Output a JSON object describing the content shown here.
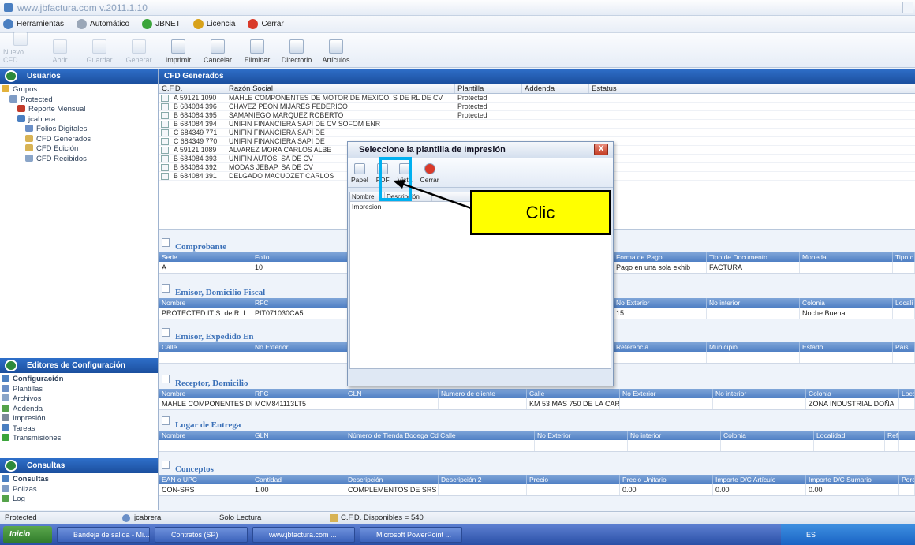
{
  "window": {
    "title": "www.jbfactura.com  v.2011.1.10"
  },
  "menu": [
    {
      "label": "Herramientas",
      "color": "#4a7fc1"
    },
    {
      "label": "Automático",
      "color": "#9aa7b8"
    },
    {
      "label": "JBNET",
      "color": "#3ba53b"
    },
    {
      "label": "Licencia",
      "color": "#d8a21a"
    },
    {
      "label": "Cerrar",
      "color": "#d93a2a"
    }
  ],
  "toolbar": [
    {
      "label": "Nuevo CFD",
      "enabled": false
    },
    {
      "label": "Abrir",
      "enabled": false
    },
    {
      "label": "Guardar",
      "enabled": false
    },
    {
      "label": "Generar",
      "enabled": false
    },
    {
      "label": "Imprimir",
      "enabled": true
    },
    {
      "label": "Cancelar",
      "enabled": true
    },
    {
      "label": "Eliminar",
      "enabled": true
    },
    {
      "label": "Directorio",
      "enabled": true
    },
    {
      "label": "Artículos",
      "enabled": true
    }
  ],
  "left": {
    "usuarios_header": "Usuarios",
    "tree": [
      {
        "label": "Grupos",
        "indent": 0,
        "color": "#e3b23c"
      },
      {
        "label": "Protected",
        "indent": 1,
        "color": "#7f9cc5"
      },
      {
        "label": "Reporte Mensual",
        "indent": 2,
        "color": "#c23b2a"
      },
      {
        "label": "jcabrera",
        "indent": 2,
        "color": "#4a7fc1"
      },
      {
        "label": "Folios Digitales",
        "indent": 3,
        "color": "#6a8fc7"
      },
      {
        "label": "CFD Generados",
        "indent": 3,
        "color": "#d8b354"
      },
      {
        "label": "CFD Edición",
        "indent": 3,
        "color": "#d8b354"
      },
      {
        "label": "CFD Recibidos",
        "indent": 3,
        "color": "#8aa5c8"
      }
    ],
    "editores_header": "Editores de Configuración",
    "config_tree": [
      {
        "label": "Configuración",
        "color": "#4a7fc1",
        "bold": true
      },
      {
        "label": "Plantillas",
        "color": "#6a8fc7"
      },
      {
        "label": "Archivos",
        "color": "#8aa5c8"
      },
      {
        "label": "Addenda",
        "color": "#55a34a"
      },
      {
        "label": "Impresión",
        "color": "#7d8a99"
      },
      {
        "label": "Tareas",
        "color": "#4a7fc1"
      },
      {
        "label": "Transmisiones",
        "color": "#3ba53b"
      }
    ],
    "consultas_header": "Consultas",
    "consultas_tree": [
      {
        "label": "Consultas",
        "color": "#4a7fc1",
        "bold": true
      },
      {
        "label": "Polizas",
        "color": "#7f9cc5"
      },
      {
        "label": "Log",
        "color": "#55a34a"
      }
    ]
  },
  "main": {
    "header": "CFD Generados",
    "columns": [
      "C.F.D.",
      "Razón Social",
      "Plantilla",
      "Addenda",
      "Estatus"
    ],
    "rows": [
      {
        "cfd": "A 59121 1090",
        "razon": "MAHLE COMPONENTES DE MOTOR DE MEXICO, S DE RL DE CV",
        "plantilla": "Protected"
      },
      {
        "cfd": "B 684084 396",
        "razon": "CHAVEZ PEON MIJARES FEDERICO",
        "plantilla": "Protected"
      },
      {
        "cfd": "B 684084 395",
        "razon": "SAMANIEGO MARQUEZ ROBERTO",
        "plantilla": "Protected"
      },
      {
        "cfd": "B 684084 394",
        "razon": "UNIFIN FINANCIERA SAPI DE CV SOFOM ENR",
        "plantilla": ""
      },
      {
        "cfd": "C 684349 771",
        "razon": "UNIFIN FINANCIERA SAPI DE",
        "plantilla": ""
      },
      {
        "cfd": "C 684349 770",
        "razon": "UNIFIN FINANCIERA SAPI DE",
        "plantilla": ""
      },
      {
        "cfd": "A 59121 1089",
        "razon": "ALVAREZ MORA CARLOS ALBE",
        "plantilla": ""
      },
      {
        "cfd": "B 684084 393",
        "razon": "UNIFIN AUTOS, SA DE CV",
        "plantilla": ""
      },
      {
        "cfd": "B 684084 392",
        "razon": "MODAS JEBAP, SA DE CV",
        "plantilla": ""
      },
      {
        "cfd": "B 684084 391",
        "razon": "DELGADO MACUOZET CARLOS",
        "plantilla": ""
      }
    ]
  },
  "detail": {
    "comprobante": {
      "title": "Comprobante",
      "left_cols": [
        "Serie",
        "Folio"
      ],
      "left_vals": [
        "A",
        "10"
      ],
      "right_cols": [
        "Forma de Pago",
        "Tipo de Documento",
        "Moneda",
        "Tipo c"
      ],
      "right_vals": [
        "Pago en una sola exhib",
        "FACTURA",
        "",
        ""
      ]
    },
    "emisor": {
      "title": "Emisor, Domicilio Fiscal",
      "left_cols": [
        "Nombre",
        "RFC"
      ],
      "left_vals": [
        "PROTECTED IT S. de R. L.",
        "PIT071030CA5"
      ],
      "right_cols": [
        "No Exterior",
        "No interior",
        "Colonia",
        "Locali"
      ],
      "right_vals": [
        "15",
        "",
        "Noche Buena",
        ""
      ]
    },
    "expedido": {
      "title": "Emisor, Expedido En",
      "left_cols": [
        "Calle",
        "No Exterior"
      ],
      "right_cols": [
        "Referencia",
        "Municipio",
        "Estado",
        "Pais"
      ]
    },
    "receptor": {
      "title": "Receptor, Domicilio",
      "cols": [
        "Nombre",
        "RFC",
        "GLN",
        "Numero de cliente",
        "Calle",
        "No Exterior",
        "No interior",
        "Colonia",
        "Locali"
      ],
      "vals": [
        "MAHLE COMPONENTES DE",
        "MCM841113LT5",
        "",
        "",
        "KM 53 MAS 750 DE LA CAR",
        "",
        "",
        "ZONA INDUSTRIAL DOÑA",
        ""
      ]
    },
    "entrega": {
      "title": "Lugar de Entrega",
      "cols": [
        "Nombre",
        "GLN",
        "Número de Tienda Bodega Cd Calle",
        "No Exterior",
        "No interior",
        "Colonia",
        "Localidad",
        "Refer"
      ]
    },
    "conceptos": {
      "title": "Conceptos",
      "cols": [
        "EAN o UPC",
        "Cantidad",
        "Descripción",
        "Descripción 2",
        "Precio",
        "Precio Unitario",
        "Importe D/C Artículo",
        "Importe D/C Sumario",
        "Porce"
      ],
      "vals": [
        "CON-SRS",
        "1.00",
        "COMPLEMENTOS DE SRS L",
        "",
        "",
        "0.00",
        "0.00",
        "0.00",
        ""
      ]
    }
  },
  "dialog": {
    "title": "Seleccione la plantilla de Impresión",
    "close_label": "X",
    "buttons": [
      "Papel",
      "PDF",
      "Vista",
      "Cerrar"
    ],
    "columns": [
      "Nombre",
      "Descripción"
    ],
    "rows": [
      "Impresion"
    ]
  },
  "callout": {
    "text": "Clic"
  },
  "status": {
    "user_group": "Protected",
    "user": "jcabrera",
    "mode": "Solo Lectura",
    "available": "C.F.D. Disponibles = 540"
  },
  "taskbar": {
    "start": "Inicio",
    "items": [
      "Bandeja de salida - Mi...",
      "Contratos (SP)",
      "www.jbfactura.com ...",
      "Microsoft PowerPoint ..."
    ],
    "tray": "ES"
  },
  "colors": {
    "accent_blue": "#1b4f9e",
    "highlight": "#00b0f0",
    "callout": "#ffff00"
  }
}
